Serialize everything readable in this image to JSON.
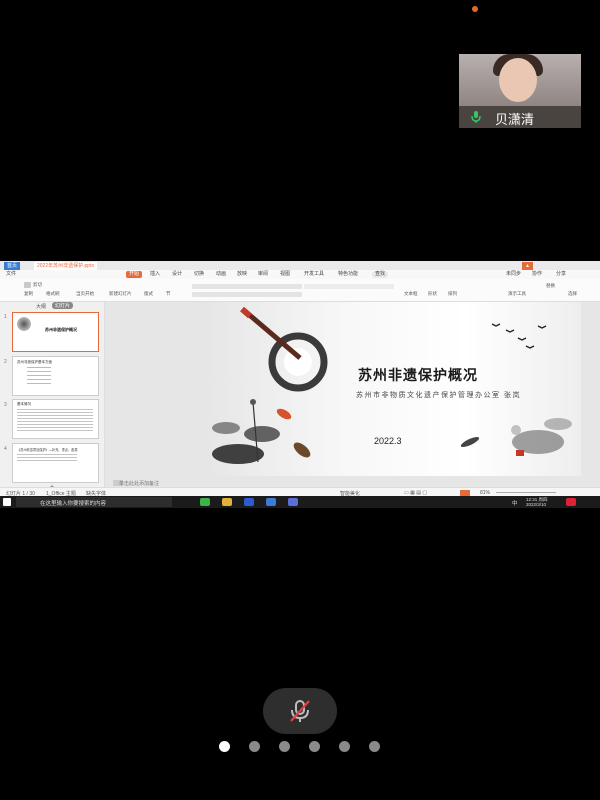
{
  "remote_participant": {
    "name": "贝潇清"
  },
  "screen_share": {
    "app": {
      "tabs": [
        "首页",
        "2022年苏州非遗保护.pptx"
      ],
      "menu": [
        "文件",
        "开始",
        "插入",
        "设计",
        "切换",
        "动画",
        "放映",
        "审阅",
        "视图",
        "开发工具",
        "特色功能"
      ],
      "search": "查找",
      "right_actions": [
        "未同步",
        "协作",
        "分享"
      ],
      "ribbon_labels": [
        "剪切",
        "复制",
        "格式刷",
        "当页开始",
        "新建幻灯片",
        "版式",
        "节",
        "文本框",
        "形状",
        "排列",
        "演示工具",
        "替换",
        "选择"
      ],
      "pane_tabs": [
        "大纲",
        "幻灯片"
      ],
      "thumbnails": [
        {
          "num": "1",
          "title": "苏州非遗保护概况"
        },
        {
          "num": "2",
          "title": "苏州非遗保护基本方面"
        },
        {
          "num": "3",
          "title": "基本情况"
        },
        {
          "num": "4",
          "title": "《苏州非遗项目保护》—补充、重点、各类"
        }
      ],
      "notes_placeholder": "单击此处添加备注"
    },
    "slide": {
      "title": "苏州非遗保护概况",
      "subtitle": "苏州市非物质文化遗产保护管理办公室 张岚",
      "date": "2022.3"
    },
    "status": {
      "slide_counter": "幻灯片 1 / 30",
      "theme": "1_Office 主题",
      "font_note": "缺失字体",
      "smart_beautify": "智能美化",
      "zoom": "81%"
    },
    "taskbar": {
      "search_placeholder": "在这里输入你要搜索的内容",
      "time": "12:31 周四",
      "date": "2022/3/10",
      "lang": "中"
    }
  },
  "controls": {
    "mute_icon": "mic-off-icon",
    "page_count": 6,
    "active_page": 1
  },
  "colors": {
    "accent": "#e66b3a",
    "slide_date": "#222222",
    "background": "#000000"
  }
}
